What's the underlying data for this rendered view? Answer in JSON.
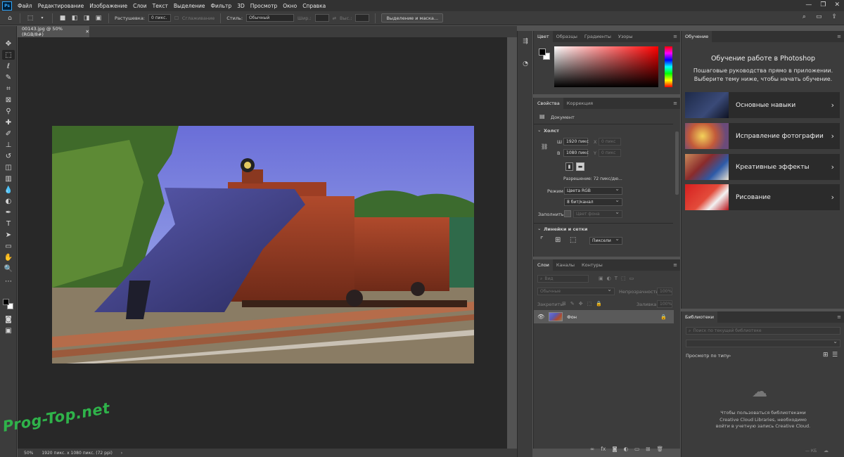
{
  "menubar": {
    "logo": "Ps",
    "items": [
      "Файл",
      "Редактирование",
      "Изображение",
      "Слои",
      "Текст",
      "Выделение",
      "Фильтр",
      "3D",
      "Просмотр",
      "Окно",
      "Справка"
    ],
    "window_buttons": [
      "—",
      "❐",
      "✕"
    ]
  },
  "options": {
    "feather_label": "Растушевка:",
    "feather_value": "0 пикс.",
    "antialias_label": "Сглаживание",
    "style_label": "Стиль:",
    "style_value": "Обычный",
    "width_label": "Шир.:",
    "height_label": "Выс.:",
    "select_mask_button": "Выделение и маска..."
  },
  "document": {
    "tab_title": "00143.jpg @ 50% (RGB/8#)",
    "zoom": "50%",
    "info": "1920 пикс. x 1080 пикс. (72 ppi)"
  },
  "watermark": "Prog-Top.net",
  "colors_panel": {
    "tabs": [
      "Цвет",
      "Образцы",
      "Градиенты",
      "Узоры"
    ]
  },
  "properties_panel": {
    "tabs": [
      "Свойства",
      "Коррекция"
    ],
    "document_label": "Документ",
    "canvas_section": "Холст",
    "w_label": "Ш",
    "w_value": "1920 пикс",
    "h_label": "В",
    "h_value": "1080 пикс",
    "x_label": "X",
    "x_value": "0 пикс",
    "y_label": "Y",
    "y_value": "0 пикс",
    "resolution": "Разрешение: 72 пикс/дю...",
    "mode_label": "Режим",
    "mode_value": "Цвета RGB",
    "depth_value": "8 бит/канал",
    "fill_label": "Заполнить",
    "fill_value": "Цвет фона",
    "rulers_section": "Линейки и сетки",
    "units_value": "Пиксели"
  },
  "layers_panel": {
    "tabs": [
      "Слои",
      "Каналы",
      "Контуры"
    ],
    "search_placeholder": "Вид",
    "blend_mode": "Обычные",
    "opacity_label": "Непрозрачность:",
    "opacity_value": "100%",
    "lock_label": "Закрепить:",
    "fill_label": "Заливка:",
    "fill_value": "100%",
    "layer_name": "Фон",
    "footer_icons": [
      "∞",
      "fx",
      "◙",
      "◐",
      "▭",
      "⊞",
      "🗑"
    ]
  },
  "learn_panel": {
    "tab": "Обучение",
    "heading": "Обучение работе в Photoshop",
    "subheading": "Пошаговые руководства прямо в приложении. Выберите тему ниже, чтобы начать обучение.",
    "items": [
      {
        "title": "Основные навыки"
      },
      {
        "title": "Исправление фотографии"
      },
      {
        "title": "Креативные эффекты"
      },
      {
        "title": "Рисование"
      }
    ]
  },
  "libraries_panel": {
    "tab": "Библиотеки",
    "search_placeholder": "Поиск по текущей библиотеке",
    "view_by": "Просмотр по типу",
    "message": "Чтобы пользоваться библиотеками Creative Cloud Libraries, необходимо войти в учетную запись Creative Cloud.",
    "size_label": "— КБ"
  }
}
